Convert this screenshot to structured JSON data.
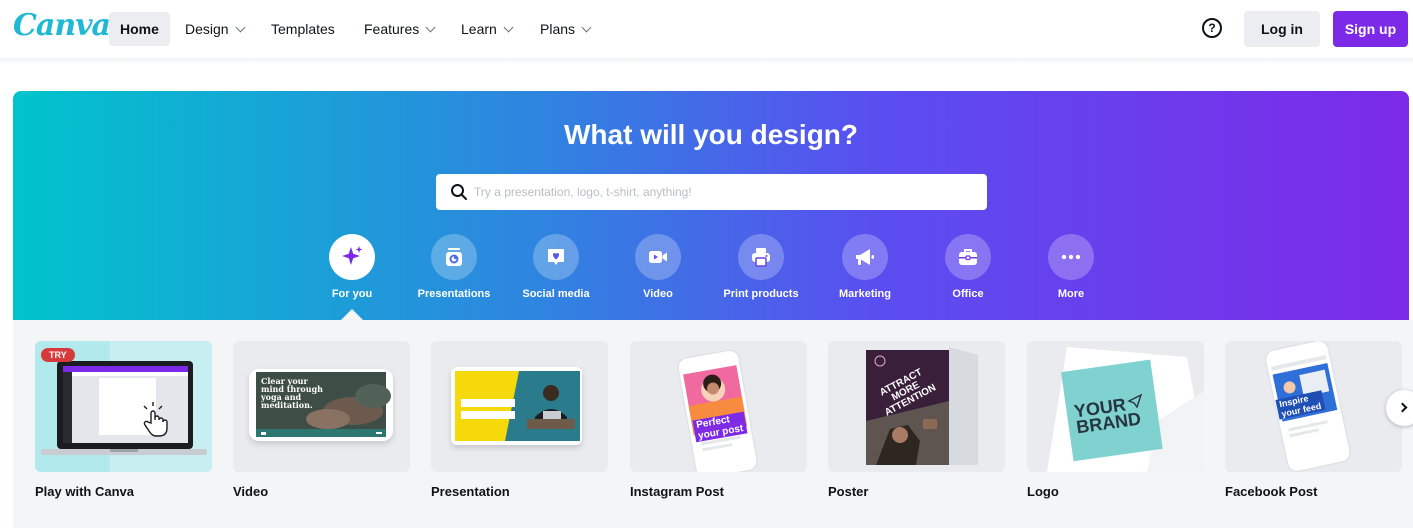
{
  "brand": {
    "logo_text": "Canva",
    "accent": "#7d2ae8",
    "logo_color": "#21b8d4"
  },
  "nav": {
    "items": [
      {
        "label": "Home",
        "has_menu": false,
        "active": true
      },
      {
        "label": "Design",
        "has_menu": true
      },
      {
        "label": "Templates",
        "has_menu": false
      },
      {
        "label": "Features",
        "has_menu": true
      },
      {
        "label": "Learn",
        "has_menu": true
      },
      {
        "label": "Plans",
        "has_menu": true
      }
    ],
    "help_icon": "question-circle-icon",
    "help_glyph": "?",
    "login_label": "Log in",
    "signup_label": "Sign up"
  },
  "hero": {
    "title": "What will you design?",
    "search_placeholder": "Try a presentation, logo, t-shirt, anything!",
    "search_value": "",
    "categories": [
      {
        "label": "For you",
        "icon": "sparkle-icon",
        "active": true
      },
      {
        "label": "Presentations",
        "icon": "presentation-icon"
      },
      {
        "label": "Social media",
        "icon": "heart-icon"
      },
      {
        "label": "Video",
        "icon": "video-camera-icon"
      },
      {
        "label": "Print products",
        "icon": "printer-icon"
      },
      {
        "label": "Marketing",
        "icon": "megaphone-icon"
      },
      {
        "label": "Office",
        "icon": "briefcase-icon"
      },
      {
        "label": "More",
        "icon": "more-dots-icon"
      }
    ]
  },
  "cards": [
    {
      "label": "Play with Canva",
      "badge": "TRY"
    },
    {
      "label": "Video",
      "thumb_text": [
        "Clear your",
        "mind through",
        "yoga and",
        "meditation."
      ]
    },
    {
      "label": "Presentation"
    },
    {
      "label": "Instagram Post",
      "thumb_text": [
        "Perfect",
        "your post"
      ]
    },
    {
      "label": "Poster",
      "thumb_text": [
        "ATTRACT",
        "MORE",
        "ATTENTION"
      ]
    },
    {
      "label": "Logo",
      "thumb_text": [
        "YOUR",
        "BRAND"
      ]
    },
    {
      "label": "Facebook Post",
      "thumb_text": [
        "Inspire",
        "your feed"
      ]
    }
  ]
}
